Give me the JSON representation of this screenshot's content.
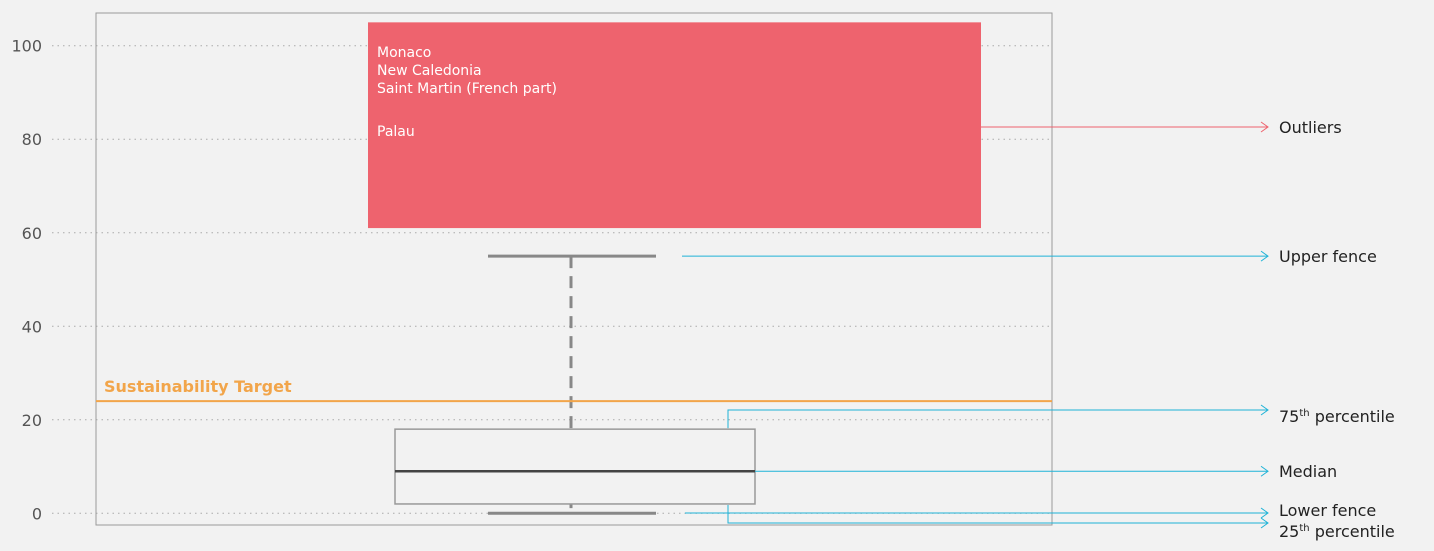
{
  "chart_data": {
    "type": "boxplot",
    "ylim": [
      -2.5,
      107
    ],
    "yticks": [
      0,
      20,
      40,
      60,
      80,
      100
    ],
    "box": {
      "q1": 2,
      "median": 9,
      "q3": 18,
      "lower_fence": 0,
      "upper_fence": 55
    },
    "outlier_region": {
      "y_min": 61,
      "y_max": 105,
      "labels": [
        "Monaco",
        "New Caledonia",
        "Saint Martin (French part)",
        "Palau"
      ]
    },
    "target": {
      "label": "Sustainability Target",
      "value": 24
    },
    "annotations": {
      "outliers": "Outliers",
      "upper_fence": "Upper fence",
      "q3_prefix": "75",
      "q3_sup": "th",
      "q3_suffix": " percentile",
      "median": "Median",
      "lower_fence": "Lower fence",
      "q1_prefix": "25",
      "q1_sup": "th",
      "q1_suffix": " percentile"
    },
    "grid": true,
    "colors": {
      "outlier": "#ee636e",
      "annotation_blue": "#1fb3d7",
      "annotation_red": "#ee636e",
      "target": "#f2a54a",
      "whisker": "#888888",
      "median": "#444444",
      "box_stroke": "#999999",
      "frame": "#9a9a9a",
      "grid": "#aaaaaa"
    }
  }
}
